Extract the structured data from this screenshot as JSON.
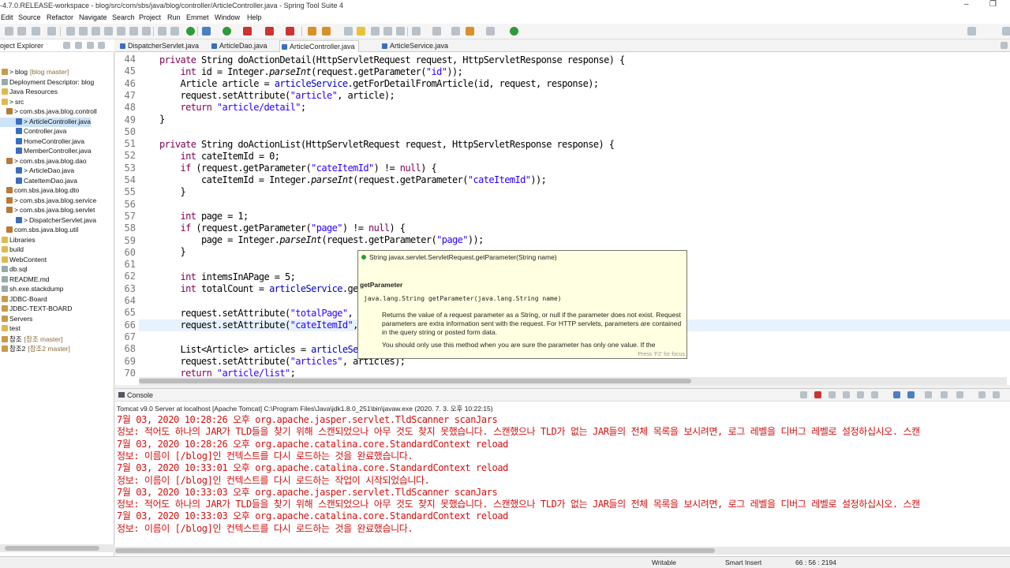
{
  "window": {
    "title": "-4.7.0.RELEASE-workspace - blog/src/com/sbs/java/blog/controller/ArticleController.java - Spring Tool Suite 4",
    "minimize": "–",
    "restore": "❐"
  },
  "menu": [
    "Edit",
    "Source",
    "Refactor",
    "Navigate",
    "Search",
    "Project",
    "Run",
    "Emmet",
    "Window",
    "Help"
  ],
  "explorer": {
    "title": "oject Explorer",
    "items": [
      {
        "label": "blog",
        "decor": "[blog master]",
        "prefix": ">"
      },
      {
        "label": "Deployment Descriptor: blog"
      },
      {
        "label": "Java Resources"
      },
      {
        "label": "src",
        "prefix": ">"
      },
      {
        "label": "com.sbs.java.blog.controll",
        "prefix": ">"
      },
      {
        "label": "ArticleController.java",
        "prefix": ">"
      },
      {
        "label": "Controller.java"
      },
      {
        "label": "HomeController.java"
      },
      {
        "label": "MemberController.java"
      },
      {
        "label": "com.sbs.java.blog.dao",
        "prefix": ">"
      },
      {
        "label": "ArticleDao.java",
        "prefix": ">"
      },
      {
        "label": "CateItemDao.java"
      },
      {
        "label": "com.sbs.java.blog.dto"
      },
      {
        "label": "com.sbs.java.blog.service",
        "prefix": ">"
      },
      {
        "label": "com.sbs.java.blog.servlet",
        "prefix": ">"
      },
      {
        "label": "DispatcherServlet.java",
        "prefix": ">"
      },
      {
        "label": "com.sbs.java.blog.util"
      },
      {
        "label": "Libraries"
      },
      {
        "label": "build"
      },
      {
        "label": "WebContent"
      },
      {
        "label": "db.sql"
      },
      {
        "label": "README.md"
      },
      {
        "label": "sh.exe.stackdump"
      },
      {
        "label": "JDBC-Board"
      },
      {
        "label": "JDBC-TEXT-BOARD"
      },
      {
        "label": "Servers"
      },
      {
        "label": "test"
      },
      {
        "label": "참조",
        "decor": "[참조 master]"
      },
      {
        "label": "참조2",
        "decor": "[참조2 master]"
      }
    ]
  },
  "editor": {
    "tabs": [
      "DispatcherServlet.java",
      "ArticleDao.java",
      "ArticleController.java",
      "ArticleService.java"
    ],
    "active_tab": 2,
    "line_numbers": [
      "44",
      "45",
      "46",
      "47",
      "48",
      "49",
      "50",
      "51",
      "52",
      "53",
      "54",
      "55",
      "56",
      "57",
      "58",
      "59",
      "60",
      "61",
      "62",
      "63",
      "64",
      "65",
      "66",
      "67",
      "68",
      "69",
      "70"
    ],
    "popup": {
      "signature": "String javax.servlet.ServletRequest.getParameter(String name)",
      "title": "getParameter",
      "declaration": "java.lang.String getParameter(java.lang.String name)",
      "description": "Returns the value of a request parameter as a String, or null if the parameter does not exist. Request parameters are extra information sent with the request. For HTTP servlets, parameters are contained in the query string or posted form data.",
      "description2": "You should only use this method when you are sure the parameter has only one value. If the",
      "focus_hint": "Press 'F2' for focus"
    }
  },
  "console": {
    "tab": "Console",
    "process": "Tomcat v9.0 Server at localhost [Apache Tomcat] C:\\Program Files\\Java\\jdk1.8.0_251\\bin\\javaw.exe  (2020. 7. 3. 오후 10:22:15)",
    "lines": [
      "7월 03, 2020 10:28:26 오후 org.apache.jasper.servlet.TldScanner scanJars",
      "정보: 적어도 하나의 JAR가 TLD들을 찾기 위해 스캔되었으나 아무 것도 찾지 못했습니다. 스캔했으나 TLD가 없는 JAR들의 전체 목록을 보시려면, 로그 레벨을 디버그 레벨로 설정하십시오. 스캔",
      "7월 03, 2020 10:28:26 오후 org.apache.catalina.core.StandardContext reload",
      "정보: 이름이 [/blog]인 컨텍스트를 다시 로드하는 것을 완료했습니다.",
      "7월 03, 2020 10:33:01 오후 org.apache.catalina.core.StandardContext reload",
      "정보: 이름이 [/blog]인 컨텍스트를 다시 로드하는 작업이 시작되었습니다.",
      "7월 03, 2020 10:33:03 오후 org.apache.jasper.servlet.TldScanner scanJars",
      "정보: 적어도 하나의 JAR가 TLD들을 찾기 위해 스캔되었으나 아무 것도 찾지 못했습니다. 스캔했으나 TLD가 없는 JAR들의 전체 목록을 보시려면, 로그 레벨을 디버그 레벨로 설정하십시오. 스캔",
      "7월 03, 2020 10:33:03 오후 org.apache.catalina.core.StandardContext reload",
      "정보: 이름이 [/blog]인 컨텍스트를 다시 로드하는 것을 완료했습니다."
    ]
  },
  "status": {
    "writable": "Writable",
    "insert_mode": "Smart Insert",
    "position": "66 : 56 : 2194"
  },
  "colors": {
    "keyword": "#7f0055",
    "string": "#2a00ff",
    "field": "#0000c0",
    "console_error": "#d01010",
    "popup_bg": "#ffffe1"
  }
}
